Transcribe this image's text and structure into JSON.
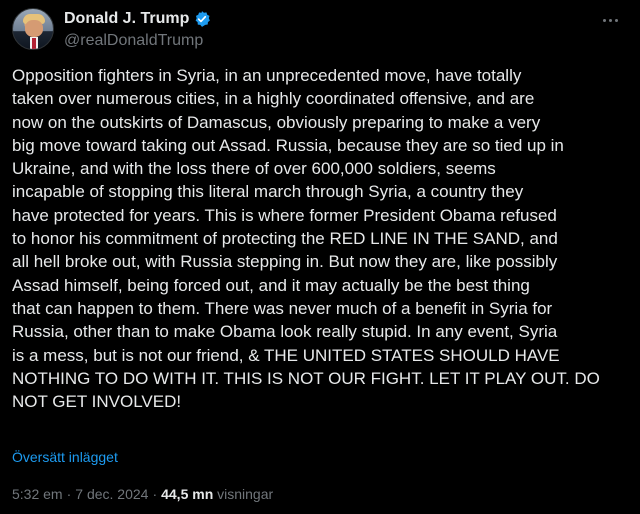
{
  "author": {
    "display_name": "Donald J. Trump",
    "handle": "@realDonaldTrump",
    "verified_icon": "verified-badge-icon",
    "avatar": "avatar-photo"
  },
  "more_menu_icon": "more-options-icon",
  "tweet": {
    "text": "Opposition fighters in Syria, in an unprecedented move, have totally\ntaken over numerous cities, in a highly coordinated offensive, and are\nnow on the outskirts of Damascus, obviously preparing to make a very\nbig move toward taking out Assad. Russia, because they are so tied up in\nUkraine, and with the loss there of over 600,000 soldiers, seems\nincapable of stopping this literal march through Syria, a country they\nhave protected for years. This is where former President Obama refused\nto honor his commitment of protecting the RED LINE IN THE SAND, and\nall hell broke out, with Russia stepping in. But now they are, like possibly\nAssad himself, being forced out, and it may actually be the best thing\nthat can happen to them. There was never much of a benefit in Syria for\nRussia, other than to make Obama look really stupid. In any event, Syria\nis a mess, but is not our friend, & THE UNITED STATES SHOULD HAVE\nNOTHING TO DO WITH IT. THIS IS NOT OUR FIGHT. LET IT PLAY OUT. DO\nNOT GET INVOLVED!",
    "translate_label": "Översätt inlägget"
  },
  "meta": {
    "time": "5:32 em",
    "separator": "·",
    "date": "7 dec. 2024",
    "views_count": "44,5 mn",
    "views_label": "visningar"
  },
  "colors": {
    "background": "#000000",
    "primary_text": "#e7e9ea",
    "secondary_text": "#71767b",
    "link": "#1d9bf0",
    "verified": "#1d9bf0"
  }
}
